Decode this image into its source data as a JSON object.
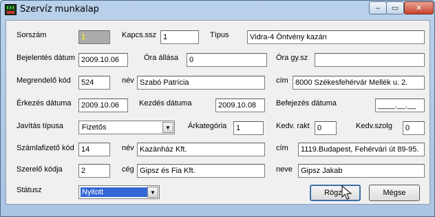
{
  "window": {
    "title": "Szervíz munkalap",
    "min_glyph": "‒",
    "max_glyph": "▭",
    "close_glyph": "✕"
  },
  "form": {
    "sorszam": {
      "label": "Sorszám",
      "value": "1"
    },
    "kapcs_ssz": {
      "label": "Kapcs.ssz",
      "value": "1"
    },
    "tipus": {
      "label": "Típus",
      "value": "Vidra-4 Öntvény kazán"
    },
    "bejelentes": {
      "label": "Bejelentés dátum",
      "value": "2009.10.06"
    },
    "ora_allasa": {
      "label": "Óra állása",
      "value": "0"
    },
    "ora_gysz": {
      "label": "Óra gy.sz",
      "value": ""
    },
    "megrendelo_kod": {
      "label": "Megrendelő kód",
      "value": "524"
    },
    "megrendelo_nev": {
      "label": "név",
      "value": "Szabó Patrícia"
    },
    "megrendelo_cim": {
      "label": "cím",
      "value": "8000 Székesfehérvár Mellék u. 2."
    },
    "erkezes": {
      "label": "Érkezés dátuma",
      "value": "2009.10.06"
    },
    "kezdes": {
      "label": "Kezdés dátuma",
      "value": "2009.10.08"
    },
    "befejezes": {
      "label": "Befejezés dátuma",
      "value": "____.__.__"
    },
    "javitas_tipusa": {
      "label": "Javítás típusa",
      "value": "Fizetős"
    },
    "arkategoria": {
      "label": "Árkategória",
      "value": "1"
    },
    "kedv_rakt": {
      "label": "Kedv. rakt",
      "value": "0"
    },
    "kedv_szolg": {
      "label": "Kedv.szolg",
      "value": "0"
    },
    "szamlafizeto_kod": {
      "label": "Számlafizető kód",
      "value": "14"
    },
    "szamlafizeto_nev": {
      "label": "név",
      "value": "Kazánház Kft."
    },
    "szamlafizeto_cim": {
      "label": "cím",
      "value": "1119.Budapest, Fehérvári út 89-95."
    },
    "szerelo_kod": {
      "label": "Szerelő kódja",
      "value": "2"
    },
    "szerelo_ceg": {
      "label": "cég",
      "value": "Gipsz és Fia Kft."
    },
    "szerelo_neve": {
      "label": "neve",
      "value": "Gipsz Jakab"
    },
    "statusz": {
      "label": "Státusz",
      "value": "Nyitott"
    }
  },
  "buttons": {
    "rogzit": "Rögzít",
    "megse": "Mégse"
  },
  "colors": {
    "disabled_field_bg": "#ababab",
    "disabled_field_text": "#ffff00",
    "selection": "#3367d6"
  },
  "icons": {
    "app": "app-icon",
    "dropdown": "chevron-down-icon",
    "cursor": "mouse-pointer-icon"
  }
}
